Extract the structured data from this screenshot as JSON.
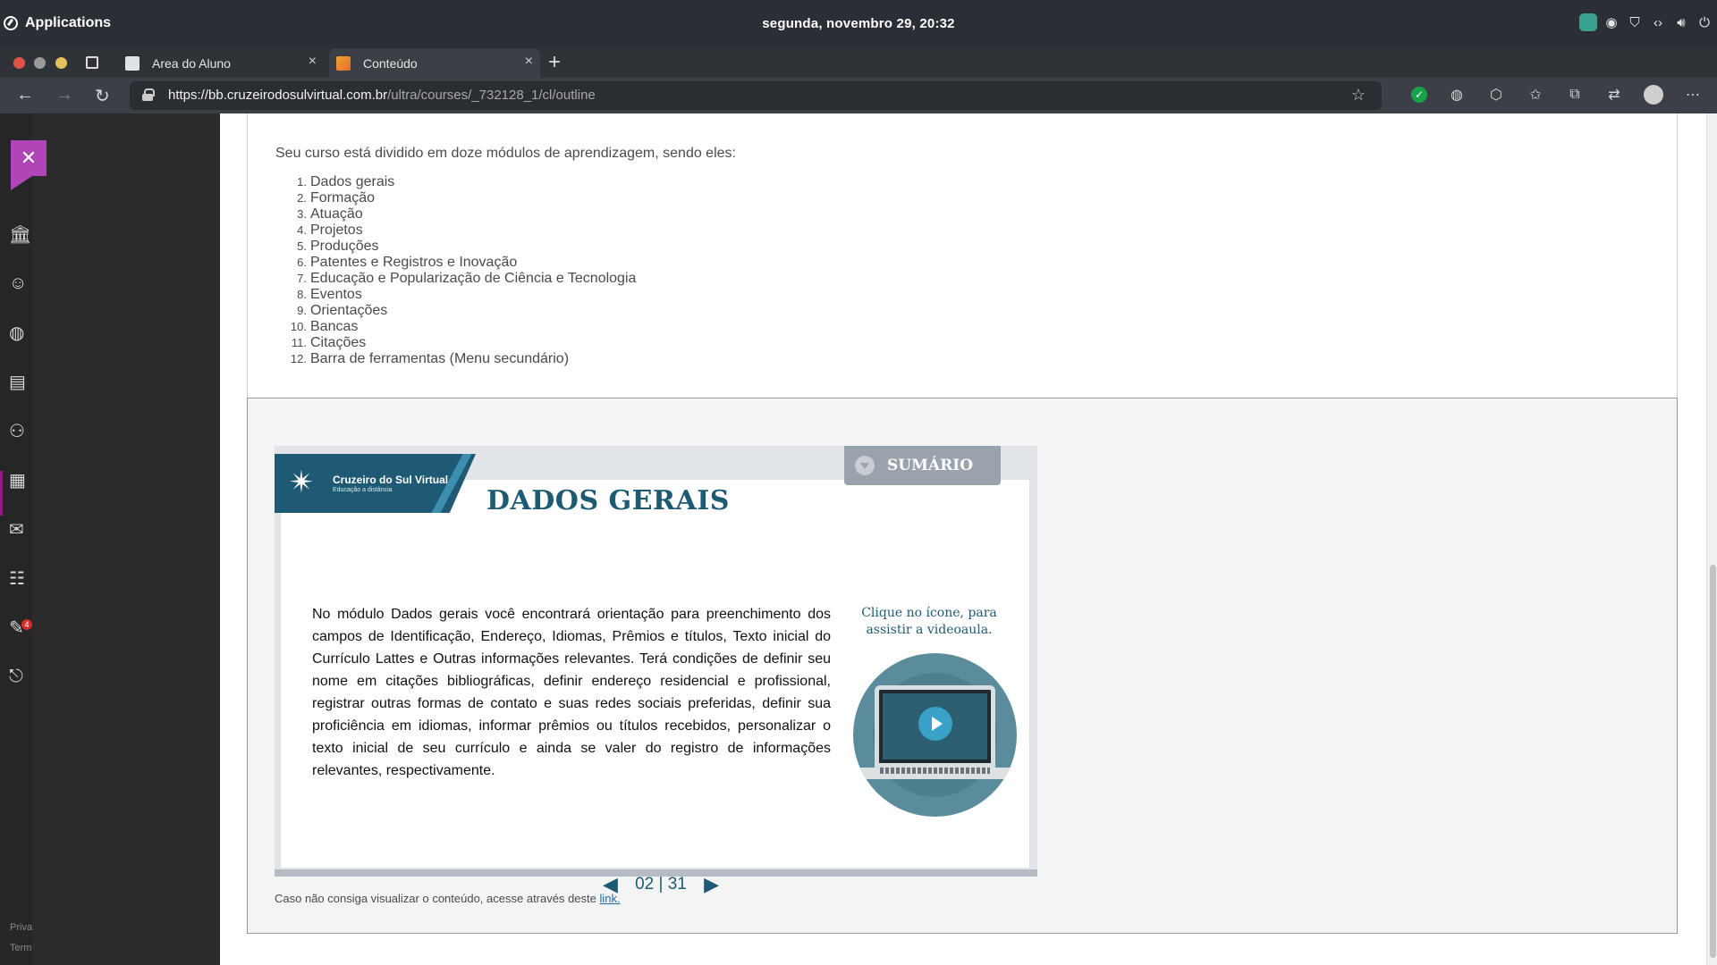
{
  "system_bar": {
    "apps_label": "Applications",
    "clock": "segunda, novembro 29, 20:32"
  },
  "browser": {
    "tabs": [
      {
        "label": "Area do Aluno"
      },
      {
        "label": "Conteúdo"
      }
    ],
    "url_host": "https://bb.cruzeirodosulvirtual.com.br",
    "url_path": "/ultra/courses/_732128_1/cl/outline"
  },
  "sidebar": {
    "mail_badge": "4",
    "footer_privacy": "Priva",
    "footer_terms": "Term"
  },
  "content": {
    "intro": "Seu curso está dividido em doze módulos de aprendizagem, sendo eles:",
    "modules": [
      {
        "num": "1.",
        "label": "Dados gerais"
      },
      {
        "num": "2.",
        "label": "Formação"
      },
      {
        "num": "3.",
        "label": "Atuação"
      },
      {
        "num": "4.",
        "label": "Projetos"
      },
      {
        "num": "5.",
        "label": "Produções"
      },
      {
        "num": "6.",
        "label": "Patentes e Registros e Inovação"
      },
      {
        "num": "7.",
        "label": "Educação e Popularização de Ciência e Tecnologia"
      },
      {
        "num": "8.",
        "label": "Eventos"
      },
      {
        "num": "9.",
        "label": "Orientações"
      },
      {
        "num": "10.",
        "label": "Bancas"
      },
      {
        "num": "11.",
        "label": "Citações"
      },
      {
        "num": "12.",
        "label": "Barra de ferramentas (Menu secundário)"
      }
    ],
    "slide": {
      "logo_name": "Cruzeiro do Sul Virtual",
      "logo_sub": "Educação a distância",
      "sumario_label": "SUMÁRIO",
      "title": "DADOS GERAIS",
      "body": "No módulo Dados gerais você encontrará orientação para preenchimento dos campos de Identificação, Endereço, Idiomas, Prêmios e títulos, Texto inicial do Currículo Lattes e Outras informações relevantes. Terá condições de definir seu nome em citações bibliográficas, definir endereço residencial e profissional, registrar outras formas de contato e suas redes sociais preferidas, definir sua proficiência em idiomas, informar prêmios ou títulos recebidos, personalizar o texto inicial de seu currículo e ainda se valer do registro de informações relevantes, respectivamente.",
      "video_caption": "Clique no ícone, para assistir a videoaula.",
      "page_indicator": "02 | 31"
    },
    "fallback_text": "Caso não consiga visualizar o conteúdo, acesse através deste ",
    "fallback_link": "link."
  },
  "colors": {
    "accent_purple": "#b045b7",
    "slide_teal": "#1d5b72",
    "play_blue": "#3aa1c8"
  }
}
